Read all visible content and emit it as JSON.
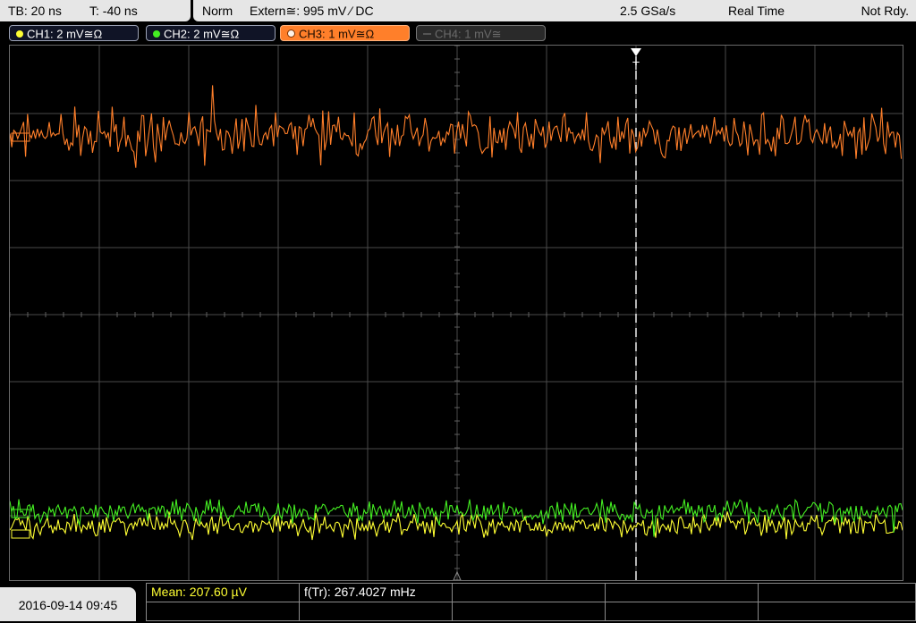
{
  "header": {
    "timebase": "TB: 20 ns",
    "trigger_offset": "T: -40 ns",
    "trigger_mode": "Norm",
    "trigger_source": "Extern≅: 995 mV ⁄ DC",
    "sample_rate": "2.5 GSa/s",
    "acq_mode": "Real Time",
    "status": "Not Rdy."
  },
  "channels": [
    {
      "label": "CH1: 2 mV≅Ω",
      "color": "#ffff33",
      "active": false
    },
    {
      "label": "CH2: 2 mV≅Ω",
      "color": "#44ee22",
      "active": false
    },
    {
      "label": "CH3: 1 mV≅Ω",
      "color": "#ff7f2a",
      "active": true
    },
    {
      "label": "CH4: 1 mV≅",
      "color": "#777777",
      "active": false
    }
  ],
  "trigger_marker": "T",
  "footer": {
    "datetime": "2016-09-14 09:45",
    "measurements": [
      {
        "label": "Mean: 207.60 µV",
        "color": "#ffff33"
      },
      {
        "label": "f(Tr): 267.4027 mHz",
        "color": "#ffffff"
      }
    ]
  },
  "colors": {
    "ch1": "#ffff33",
    "ch2": "#44ee22",
    "ch3": "#ff7f2a",
    "grid": "#4a4a4a",
    "panel": "#e6e6e6"
  }
}
